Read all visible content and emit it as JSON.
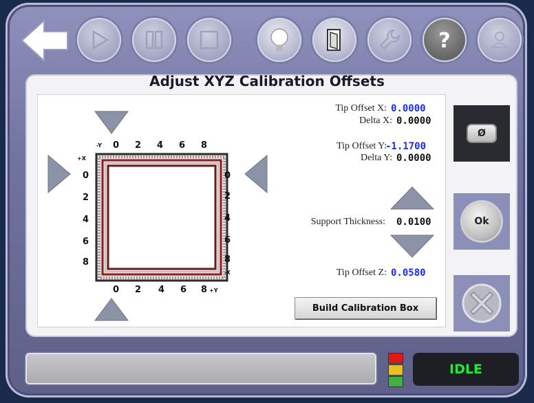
{
  "title": "Adjust XYZ Calibration Offsets",
  "toolbar": {
    "buttons": [
      {
        "name": "back",
        "icon": "back-arrow-icon"
      },
      {
        "name": "play",
        "icon": "play-icon"
      },
      {
        "name": "pause",
        "icon": "pause-icon"
      },
      {
        "name": "stop",
        "icon": "stop-icon"
      },
      {
        "name": "light",
        "icon": "lightbulb-icon"
      },
      {
        "name": "door",
        "icon": "door-icon"
      },
      {
        "name": "tools",
        "icon": "wrench-icon"
      },
      {
        "name": "help",
        "icon": "help-icon",
        "text": "?"
      },
      {
        "name": "user",
        "icon": "user-icon"
      }
    ]
  },
  "grid": {
    "top_axis_label": "-Y",
    "top_ticks": [
      "0",
      "2",
      "4",
      "6",
      "8"
    ],
    "bottom_ticks": [
      "0",
      "2",
      "4",
      "6",
      "8"
    ],
    "bottom_axis_label": "+Y",
    "left_axis_label": "+X",
    "left_ticks": [
      "0",
      "2",
      "4",
      "6",
      "8"
    ],
    "right_ticks": [
      "0",
      "2",
      "4",
      "6",
      "8"
    ],
    "right_axis_label": "-X"
  },
  "offsets": {
    "tip_x_label": "Tip Offset X:",
    "tip_x_value": "0.0000",
    "delta_x_label": "Delta X:",
    "delta_x_value": "0.0000",
    "tip_y_label": "Tip Offset Y:",
    "tip_y_value": "-1.1700",
    "delta_y_label": "Delta Y:",
    "delta_y_value": "0.0000",
    "support_label": "Support Thickness:",
    "support_value": "0.0100",
    "tip_z_label": "Tip Offset Z:",
    "tip_z_value": "0.0580"
  },
  "build_button_label": "Build Calibration Box",
  "side_buttons": {
    "reset_label": "Ø",
    "ok_label": "Ok"
  },
  "status": {
    "state": "IDLE",
    "progress_text": ""
  },
  "colors": {
    "value_blue": "#1a2cff",
    "idle_green": "#22e838",
    "light_red": "#e01818",
    "light_yellow": "#e8c020",
    "light_green": "#40b040"
  }
}
